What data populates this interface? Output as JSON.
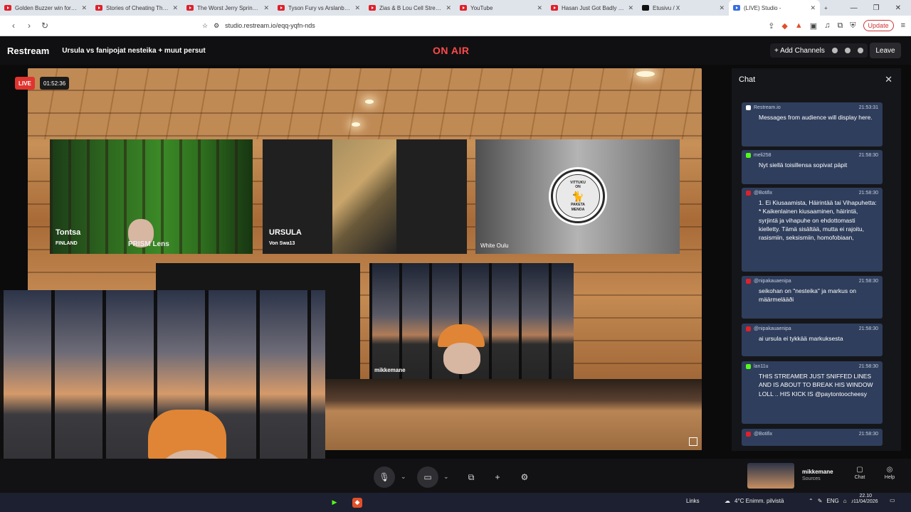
{
  "browser": {
    "tabs": [
      {
        "title": "Golden Buzzer win for Ted",
        "favicon": "youtube-icon"
      },
      {
        "title": "Stories of Cheating That A",
        "favicon": "youtube-icon"
      },
      {
        "title": "The Worst Jerry Springer G",
        "favicon": "youtube-icon"
      },
      {
        "title": "Tyson Fury vs Arslanbek M",
        "favicon": "youtube-icon"
      },
      {
        "title": "Zias & B Lou Cell Streamer",
        "favicon": "youtube-icon"
      },
      {
        "title": "YouTube",
        "favicon": "youtube-icon"
      },
      {
        "title": "Hasan Just Got Badly Expo",
        "favicon": "youtube-icon"
      },
      {
        "title": "Etusivu / X",
        "favicon": "x-icon"
      },
      {
        "title": "(LIVE) Studio -",
        "favicon": "restream-icon"
      }
    ],
    "url": "studio.restream.io/eqq-yqfn-nds",
    "update_label": "Update"
  },
  "app": {
    "logo": "Restream",
    "title": "Ursula vs fanipojat nesteika + muut persut",
    "on_air": "ON AIR",
    "add_channels": "+ Add Channels",
    "leave": "Leave",
    "live_badge": "LIVE",
    "timer": "01:52:36"
  },
  "stage": {
    "tiles": [
      {
        "name": "Tontsa",
        "sub": "FINLAND",
        "overlay": "PRISM Lens"
      },
      {
        "name": "URSULA",
        "sub": "Von Swa13"
      },
      {
        "name": "White Oulu",
        "badge": [
          "VITTUKU",
          "ON",
          "PAKETA",
          "MENOA"
        ]
      },
      {
        "name": ""
      },
      {
        "name": "mikkemane"
      }
    ]
  },
  "chat": {
    "header": "Chat",
    "messages": [
      {
        "user": "Restream.io",
        "time": "21:53:31",
        "text": "Messages from audience will display here.",
        "source": "restream"
      },
      {
        "user": "meli258",
        "time": "21:58:30",
        "text": "Nyt siellä toisillensa sopivat päpit",
        "source": "kick"
      },
      {
        "user": "@Botifix",
        "time": "21:58:30",
        "text": "1. Ei Kiusaamista, Häirintää tai Vihapuhetta: * Kaikenlainen kiusaaminen, häirintä, syrjintä ja vihapuhe on ehdottomasti kielletty. Tämä sisältää, mutta ei rajoitu, rasismiin, seksismiin, homofobiaan,",
        "source": "youtube"
      },
      {
        "user": "@nipakauaenipa",
        "time": "21:58:30",
        "text": "seikohan on \"nesteika\" ja markus on määrmelääði",
        "source": "youtube"
      },
      {
        "user": "@nipakauaenipa",
        "time": "21:58:30",
        "text": "ai ursula ei tykkää markuksesta",
        "source": "youtube"
      },
      {
        "user": "lan11u",
        "time": "21:58:30",
        "text": "THIS STREAMER JUST SNIFFED LINES AND IS ABOUT TO BREAK HIS WINDOW LOLL .. HIS KICK IS @paytontoocheesy",
        "source": "kick"
      },
      {
        "user": "@Botifix",
        "time": "21:58:30",
        "text": "",
        "source": "youtube"
      }
    ]
  },
  "controls": {
    "source_name": "mikkemane",
    "source_sub": "Sources",
    "chat_label": "Chat",
    "help_label": "Help"
  },
  "taskbar": {
    "links": "Links",
    "weather": "4°C  Enimm. pilvistä",
    "lang": "ENG",
    "time": "22.10",
    "date": "11/04/2026"
  },
  "colors": {
    "on_air": "#ff4a4a",
    "live_badge": "#e0342f",
    "chat_bubble": "#2f3e5c",
    "kick": "#53fc18",
    "youtube": "#e0202a"
  }
}
